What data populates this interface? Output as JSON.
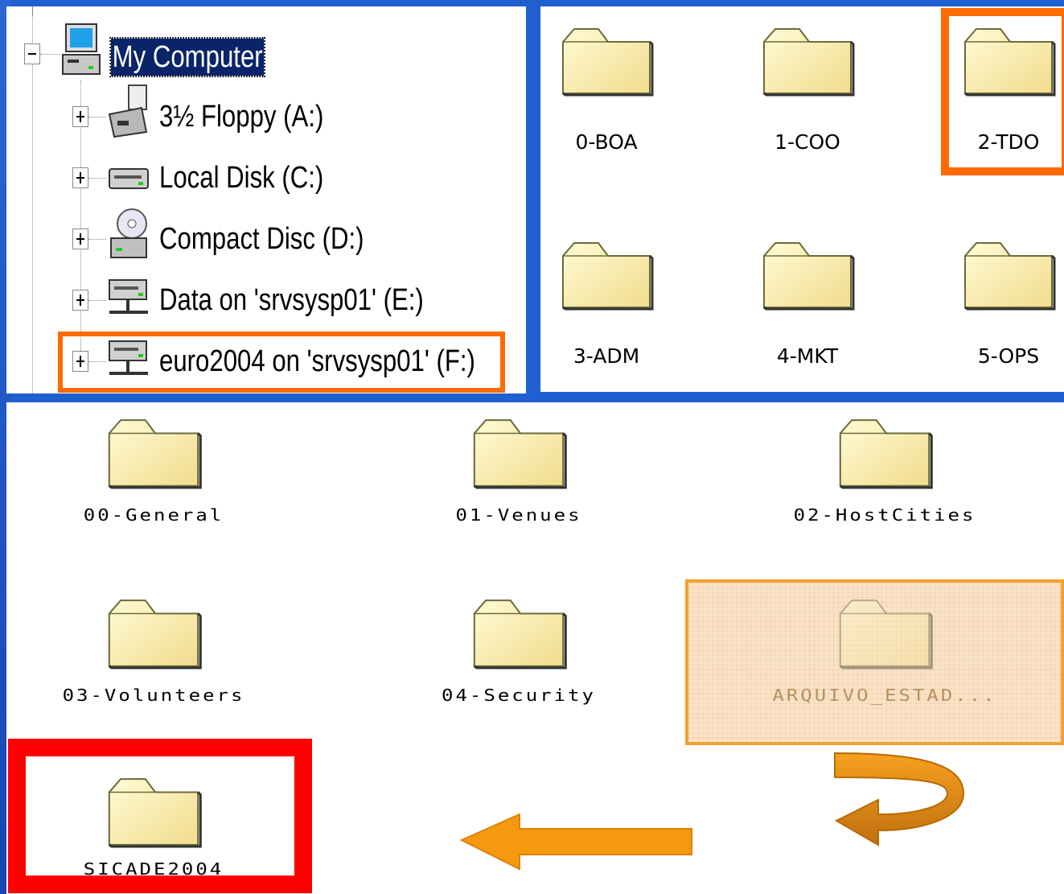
{
  "tree": {
    "root_label": "My Computer",
    "drives": [
      {
        "label": "3½ Floppy (A:)",
        "icon": "floppy-drive-icon"
      },
      {
        "label": "Local Disk (C:)",
        "icon": "hard-disk-icon"
      },
      {
        "label": "Compact Disc (D:)",
        "icon": "cd-drive-icon"
      },
      {
        "label": "Data on 'srvsysp01' (E:)",
        "icon": "network-drive-icon"
      },
      {
        "label": "euro2004 on 'srvsysp01' (F:)",
        "icon": "network-drive-icon"
      }
    ]
  },
  "departments": {
    "folders": [
      "0-BOA",
      "1-COO",
      "2-TDO",
      "3-ADM",
      "4-MKT",
      "5-OPS"
    ],
    "highlighted": "2-TDO"
  },
  "tdo_folders": {
    "folders": [
      "00-General",
      "01-Venues",
      "02-HostCities",
      "03-Volunteers",
      "04-Security",
      "ARQUIVO_ESTAD...",
      "SICADE2004"
    ],
    "selected": "ARQUIVO_ESTAD...",
    "target": "SICADE2004"
  },
  "colors": {
    "highlight_orange": "#ff6a00",
    "target_red": "#ff0000",
    "arrow_orange": "#f59a10",
    "selection_fill": "#f9e3c8"
  }
}
